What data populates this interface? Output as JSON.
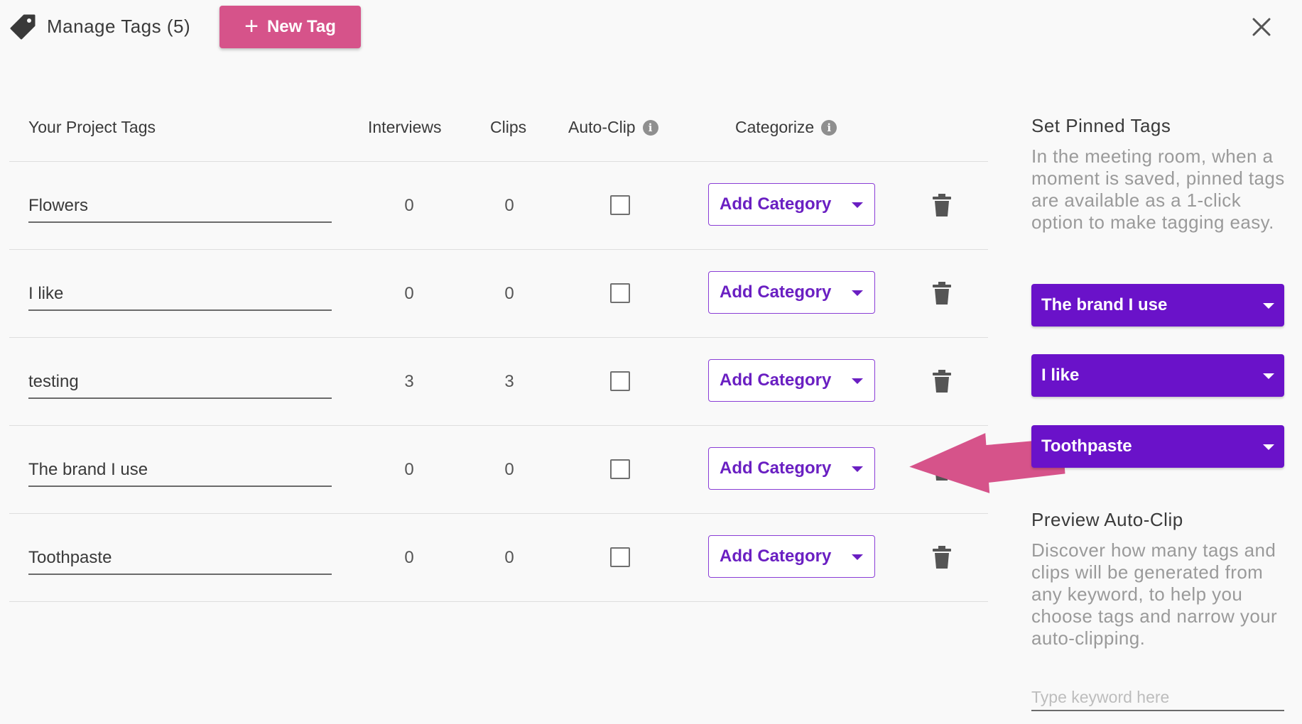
{
  "header": {
    "title": "Manage Tags (5)",
    "new_tag_label": "New Tag",
    "new_tag_plus": "+"
  },
  "table": {
    "columns": {
      "tags": "Your Project Tags",
      "interviews": "Interviews",
      "clips": "Clips",
      "autoclip": "Auto-Clip",
      "categorize": "Categorize"
    },
    "info_glyph": "i",
    "rows": [
      {
        "name": "Flowers",
        "interviews": "0",
        "clips": "0",
        "auto_clip": false,
        "category": "Add Category"
      },
      {
        "name": "I like",
        "interviews": "0",
        "clips": "0",
        "auto_clip": false,
        "category": "Add Category"
      },
      {
        "name": "testing",
        "interviews": "3",
        "clips": "3",
        "auto_clip": false,
        "category": "Add Category"
      },
      {
        "name": "The brand I use",
        "interviews": "0",
        "clips": "0",
        "auto_clip": false,
        "category": "Add Category"
      },
      {
        "name": "Toothpaste",
        "interviews": "0",
        "clips": "0",
        "auto_clip": false,
        "category": "Add Category"
      }
    ]
  },
  "sidebar": {
    "pinned_title": "Set Pinned Tags",
    "pinned_desc": "In the meeting room, when a moment is saved, pinned tags are available as a 1-click option to make tagging easy.",
    "pinned": [
      "The brand I use",
      "I like",
      "Toothpaste"
    ],
    "preview_title": "Preview Auto-Clip",
    "preview_desc": "Discover how many tags and clips will be generated from any keyword, to help you choose tags and narrow your auto-clipping.",
    "keyword_placeholder": "Type keyword here"
  },
  "colors": {
    "new_tag_button": "#d6538a",
    "accent_purple": "#6a12c9",
    "annotation_arrow": "#d6538a"
  },
  "icons": [
    "tag-icon",
    "plus-icon",
    "close-icon",
    "info-icon",
    "chevron-down-icon",
    "trash-icon",
    "arrow-annotation"
  ]
}
